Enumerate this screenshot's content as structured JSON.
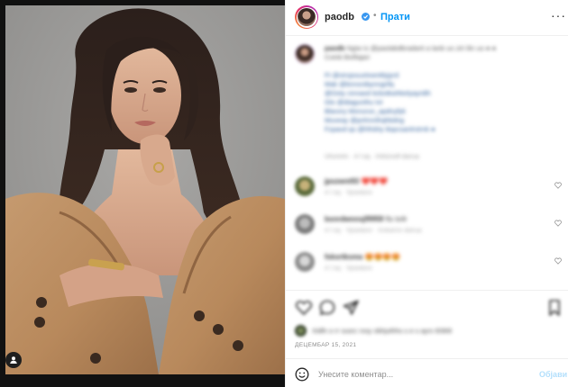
{
  "header": {
    "username": "paodb",
    "separator": "•",
    "follow_label": "Прати",
    "more_label": "···"
  },
  "caption": {
    "username": "paodb",
    "lines": [
      "Ngiw is @paolabdbradarti a lanb uo ziri ilin uo ● ●",
      "Coinb Bxiflajari",
      "",
      "Ft @xirsjosuxlxwnttlyjyrd",
      "Mak @bnnsnibynngrifq",
      "@Oxty cinnaxd ticbxtkwhkelyayrdih",
      "Glo @diagunthu tvt",
      "Blavxry Mxnurun_apdnyfyk",
      "Muveay @pnhnnthqhbdng",
      "Fzpavd qs @hfrdrty tlopcsanlrstrnk ●"
    ],
    "meta": "Uhxmrtn · 4 f oq · Xrktznoff dwrua"
  },
  "comments": [
    {
      "user": "jpszwnt93",
      "text": "❤️❤️❤️",
      "meta": "4 f oq · Ypsedonr"
    },
    {
      "user": "bsnrdwnnsjf9959",
      "text": "fts ts4r",
      "meta": "4 f oq · Ypsedonr · Xnkwrnn dwrua"
    },
    {
      "user": "fsksrtksma",
      "text": "😍😍😍😍",
      "meta": "4 f oq · Ypsedonr"
    }
  ],
  "likes": {
    "text": "Xidfn o rr susrc rxsy vbhjuthhs s e s ayrx 839i9"
  },
  "date": "ДЕЦЕМБАР 15, 2021",
  "comment_box": {
    "placeholder": "Унесите коментар...",
    "post_label": "Објави"
  },
  "icons": {
    "header_more": "more-options-icon",
    "verified": "verified-badge-icon",
    "like": "heart-icon",
    "comment": "comment-icon",
    "share": "share-icon",
    "save": "bookmark-icon",
    "emoji": "emoji-icon",
    "tag": "user-tag-icon"
  },
  "colors": {
    "accent": "#0095f6",
    "verified": "#3897f0",
    "text": "#262626",
    "muted": "#8e8e8e",
    "border": "#efefef",
    "post_disabled": "#b2dffc"
  }
}
